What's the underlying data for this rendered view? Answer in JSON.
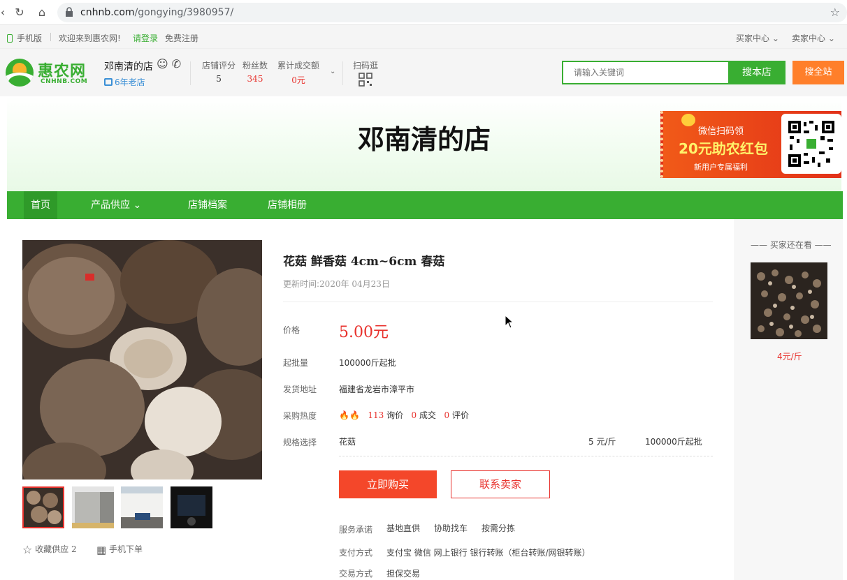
{
  "browser": {
    "url_host": "cnhnb.com",
    "url_path": "/gongying/3980957/"
  },
  "topbar": {
    "mobile": "手机版",
    "welcome": "欢迎来到惠农网!",
    "login": "请登录",
    "register": "免费注册",
    "buyer_center": "买家中心",
    "seller_center": "卖家中心"
  },
  "header": {
    "logo_name": "惠农网",
    "logo_domain": "CNHNB.COM",
    "shop_name": "邓南清的店",
    "old_shop": "6年老店",
    "stats": [
      {
        "label": "店铺评分",
        "value": "5"
      },
      {
        "label": "粉丝数",
        "value": "345"
      },
      {
        "label": "累计成交额",
        "value": "0元"
      }
    ],
    "scan_label": "扫码逛",
    "search_placeholder": "请输入关键词",
    "search_shop": "搜本店",
    "search_all": "搜全站"
  },
  "banner": {
    "title": "邓南清的店",
    "promo_line1": "微信扫码领",
    "promo_line2": "20元助农红包",
    "promo_line3": "新用户专属福利"
  },
  "nav": {
    "items": [
      "首页",
      "产品供应",
      "店铺档案",
      "店铺相册"
    ]
  },
  "product": {
    "title": "花菇 鲜香菇 4cm~6cm 春菇",
    "update_label": "更新时间:",
    "update_date": "2020年 04月23日",
    "price_label": "价格",
    "price": "5.00元",
    "moq_label": "起批量",
    "moq": "100000斤起批",
    "ship_label": "发货地址",
    "ship_from": "福建省龙岩市漳平市",
    "heat_label": "采购热度",
    "heat": {
      "inquiries": "113",
      "inquiries_label": "询价",
      "deals": "0",
      "deals_label": "成交",
      "reviews": "0",
      "reviews_label": "评价"
    },
    "spec_label": "规格选择",
    "spec": {
      "name": "花菇",
      "price": "5 元/斤",
      "min": "100000斤起批"
    },
    "buy_now": "立即购买",
    "contact_seller": "联系卖家",
    "service_label": "服务承诺",
    "services": [
      "基地直供",
      "协助找车",
      "按需分拣"
    ],
    "payment_label": "支付方式",
    "payment": "支付宝 微信 网上银行 银行转账（柜台转账/网银转账）",
    "trade_label": "交易方式",
    "trade": "担保交易",
    "collect": "收藏供应",
    "collect_count": "2",
    "mobile_order": "手机下单"
  },
  "sidebar": {
    "heading": "买家还在看",
    "price": "4元/斤"
  },
  "colors": {
    "brand_green": "#39ae32",
    "accent_red": "#e8322d",
    "search_all_orange": "#ff7f2a"
  }
}
